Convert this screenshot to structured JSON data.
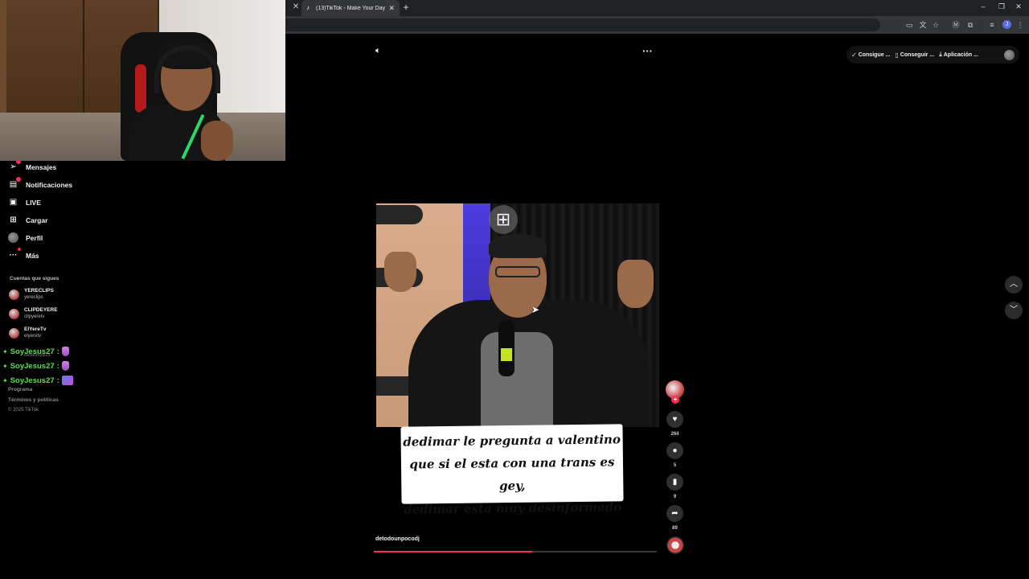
{
  "browser": {
    "tab_title": "(13)TikTok - Make Your Day",
    "new_tab_symbol": "+",
    "window_controls": [
      "–",
      "❐",
      "✕"
    ],
    "profile_initial": "J"
  },
  "header": {
    "buttons": [
      {
        "label": "Consigue ...",
        "icon": "check-circle-icon"
      },
      {
        "label": "Conseguir ...",
        "icon": "phone-icon"
      },
      {
        "label": "Aplicación ...",
        "icon": "download-icon"
      }
    ]
  },
  "sidebar": {
    "items": [
      {
        "label": "Mensajes",
        "icon": "paper-plane-icon",
        "badge": true
      },
      {
        "label": "Notificaciones",
        "icon": "inbox-icon",
        "badge": true
      },
      {
        "label": "LIVE",
        "icon": "live-icon",
        "badge": false
      },
      {
        "label": "Cargar",
        "icon": "upload-plus-icon",
        "badge": false
      },
      {
        "label": "Perfil",
        "icon": "avatar",
        "badge": false
      },
      {
        "label": "Más",
        "icon": "more-dots-icon",
        "badge": true
      }
    ],
    "following_title": "Cuentas que sigues",
    "following": [
      {
        "name": "YERECLIPS",
        "username": "yereclips"
      },
      {
        "name": "CLIPDEYERE",
        "username": "clipyeretv"
      },
      {
        "name": "ElYereTv",
        "username": "elyeretv"
      }
    ],
    "under_chat_text": "stefanmyal25",
    "footer_links": [
      "Programa",
      "Términos y políticas"
    ],
    "copyright": "© 2025 TikTok"
  },
  "chat": {
    "messages": [
      {
        "user": "SoyJesus27",
        "emote": "pink"
      },
      {
        "user": "SoyJesus27",
        "emote": "pink"
      },
      {
        "user": "SoyJesus27",
        "emote": "multi"
      }
    ]
  },
  "video": {
    "caption_lines": [
      "dedimar le pregunta a valentino",
      "que si el esta con una trans es gey,",
      "dedimar esta muy desinformado"
    ],
    "author": "detodounpocodj",
    "progress": 0.56,
    "likes": "264",
    "comments": "5",
    "saves": "9",
    "shares": "89"
  },
  "colors": {
    "accent": "#fe2c55",
    "chat_name": "#58e04a",
    "background": "#000000"
  }
}
